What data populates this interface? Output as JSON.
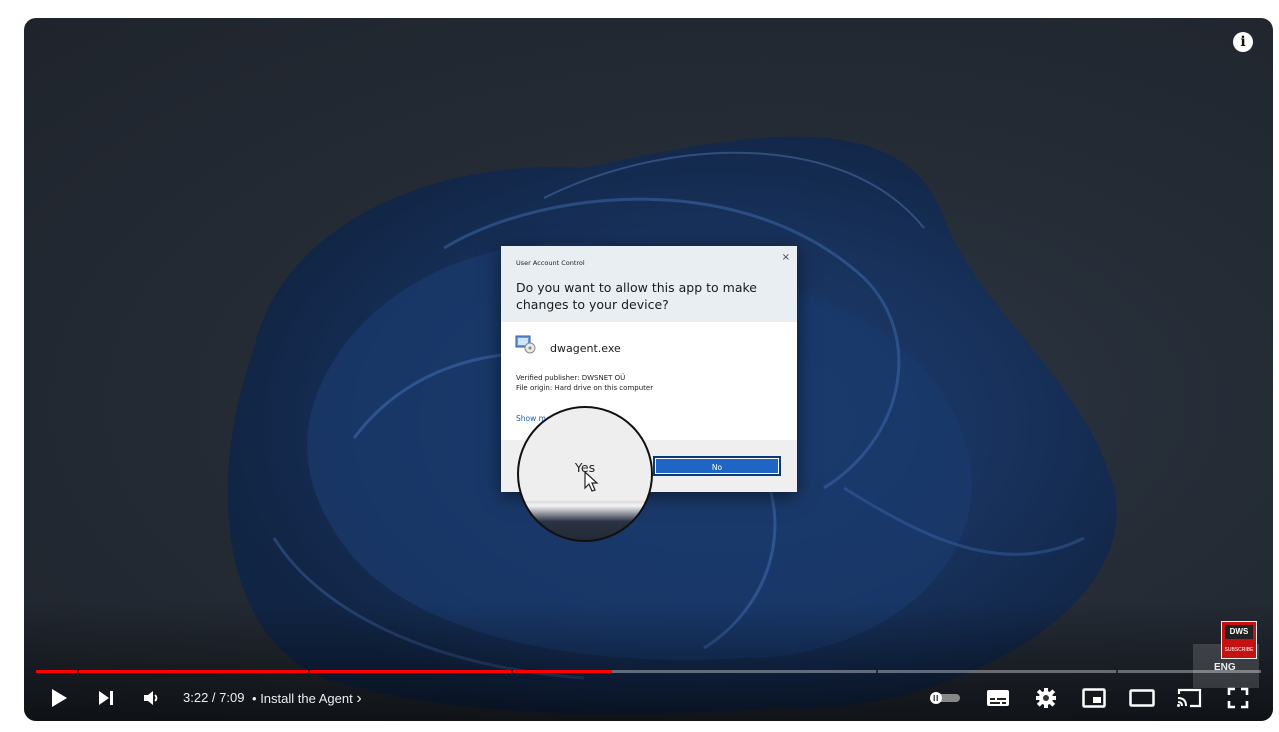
{
  "player": {
    "info_icon": "info-icon",
    "time_display": "3:22 / 7:09",
    "chapter_separator": "•",
    "chapter_title": "Install the Agent",
    "chapter_chevron": "›",
    "progress_fraction": 0.47,
    "language_badge": "ENG",
    "colors": {
      "played": "#ff0000",
      "dialog_no_button": "#1f65c3"
    }
  },
  "uac": {
    "caption": "User Account Control",
    "close_glyph": "×",
    "question": "Do you want to allow this app to make changes to your device?",
    "app_name": "dwagent.exe",
    "publisher": "Verified publisher: DWSNET OÜ",
    "origin": "File origin: Hard drive on this computer",
    "show_more": "Show m",
    "yes_label": "Yes",
    "no_label": "No"
  },
  "brand": {
    "badge_text": "DWS",
    "subscribe_text": "SUBSCRIBE"
  },
  "icons": {
    "play": "play-icon",
    "next": "next-icon",
    "volume": "volume-icon",
    "autoplay": "autoplay-toggle-icon",
    "subtitles": "subtitles-icon",
    "settings": "gear-icon",
    "miniplayer": "miniplayer-icon",
    "theater": "theater-icon",
    "cast": "cast-icon",
    "fullscreen": "fullscreen-icon"
  }
}
